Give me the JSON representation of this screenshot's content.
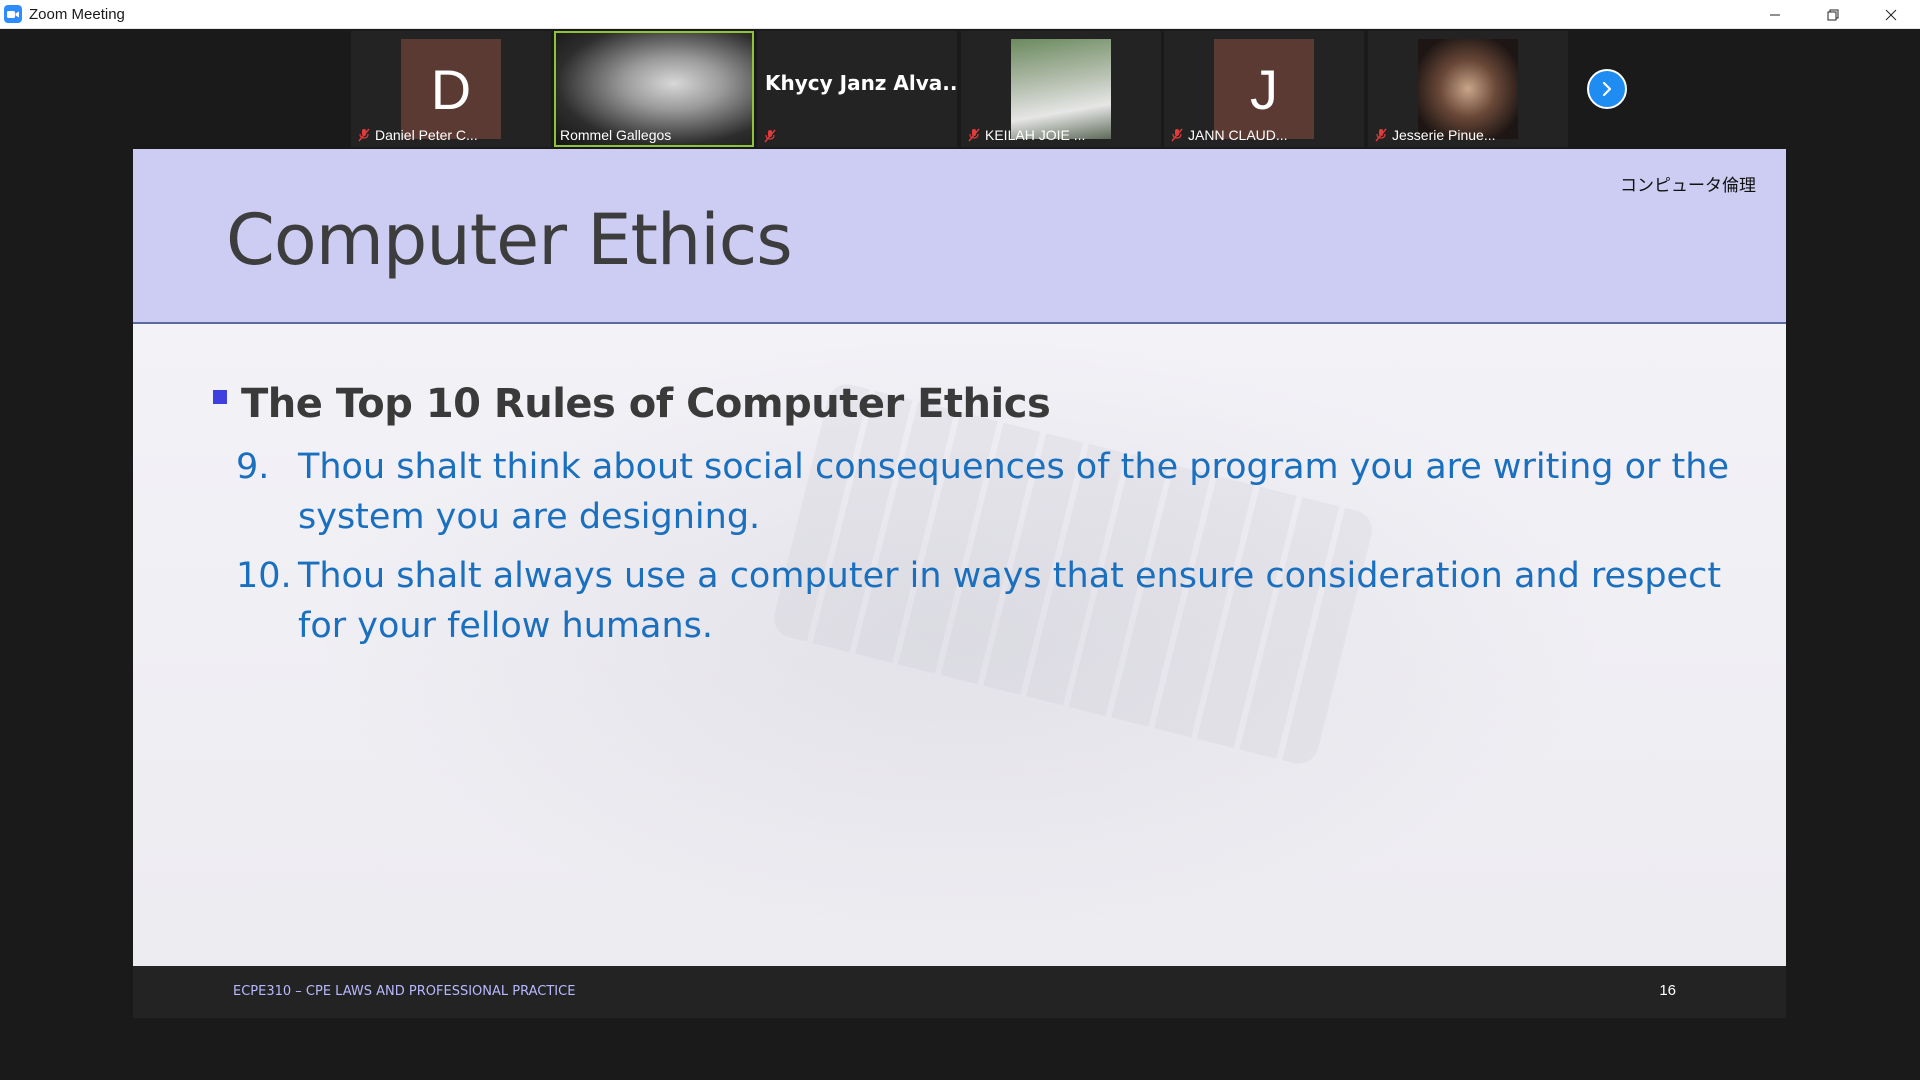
{
  "window": {
    "title": "Zoom Meeting",
    "controls": [
      "minimize",
      "restore",
      "close"
    ]
  },
  "participants": [
    {
      "name": "Daniel Peter C...",
      "avatar_letter": "D",
      "muted": true
    },
    {
      "name": "Rommel Gallegos",
      "video": true,
      "active_speaker": true
    },
    {
      "name": "Khycy  Janz  Alva...",
      "muted": true
    },
    {
      "name": "KEILAH JOIE ...",
      "video": true,
      "muted": true
    },
    {
      "name": "JANN CLAUD...",
      "avatar_letter": "J",
      "muted": true
    },
    {
      "name": "Jesserie Pinue...",
      "video": true,
      "muted": true
    }
  ],
  "strip": {
    "next_icon": "chevron-right-icon"
  },
  "slide": {
    "corner_label": "コンピュータ倫理",
    "title": "Computer Ethics",
    "bullet": "The Top 10 Rules of Computer Ethics",
    "rules": [
      {
        "num": "9.",
        "text": "Thou shalt think about social consequences of the program you are writing or the system you are designing."
      },
      {
        "num": "10.",
        "text": "Thou shalt  always use a computer in ways that ensure consideration and respect for your fellow humans."
      }
    ],
    "footer_left": "ECPE310 – CPE LAWS AND PROFESSIONAL PRACTICE",
    "page_number": "16"
  },
  "colors": {
    "header_band": "#cdcdf3",
    "rule_text": "#1a6fbf",
    "bullet_square": "#3f3fe0",
    "active_speaker_border": "#8fc43a",
    "next_button": "#1f8cf2"
  }
}
